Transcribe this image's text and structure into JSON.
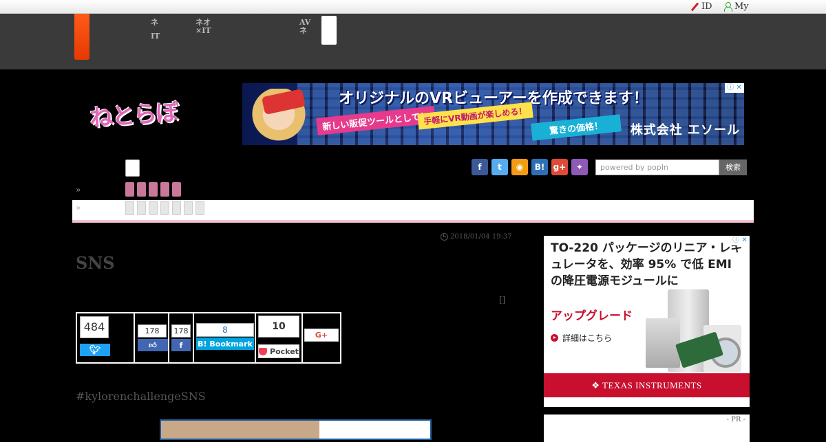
{
  "topbar": {
    "id_label": "ID",
    "my_label": "My"
  },
  "nav": {
    "item1": {
      "line1": "ネ",
      "line2": "IT"
    },
    "item2": {
      "line1": "ネオ",
      "line2": "×IT"
    },
    "item3": {
      "line1": "AV",
      "line2": "ネ"
    }
  },
  "logo": {
    "text": "ねとらぼ"
  },
  "vr_ad": {
    "headline": "オリジナルのVRビューアーを作成できます！",
    "tag1": "新しい販促ツールとして！",
    "tag2": "手軽にVR動画が楽しめる！",
    "tag3": "驚きの価格！",
    "company": "株式会社 エソール",
    "badge": "ⓘ ✕"
  },
  "social": {
    "icons": [
      {
        "name": "facebook-share-icon",
        "glyph": "f",
        "color": "#3b5998"
      },
      {
        "name": "twitter-share-icon",
        "glyph": "t",
        "color": "#55acee"
      },
      {
        "name": "rss-icon",
        "glyph": "◉",
        "color": "#f39c12"
      },
      {
        "name": "hatena-bookmark-icon",
        "glyph": "B!",
        "color": "#2f6fb6"
      },
      {
        "name": "google-plus-icon",
        "glyph": "g+",
        "color": "#dd4b39"
      },
      {
        "name": "mascot-cat-icon",
        "glyph": "✦",
        "color": "#8e5ab5"
      }
    ]
  },
  "search": {
    "placeholder": "powered by popIn",
    "button": "検索"
  },
  "crumbs": {
    "arrow1": "»",
    "arrow2": "»"
  },
  "article": {
    "date": "2018/01/04 19:37",
    "title": "SNS",
    "bracket": "[]",
    "hashtag": "#kylorenchallengeSNS"
  },
  "share": {
    "tweet_count": "484",
    "like_count": "178",
    "fb_share_count": "178",
    "bookmark_count": "8",
    "bookmark_label": "B! Bookmark",
    "pocket_count": "10",
    "pocket_label": "Pocket",
    "gplus_label": "G+"
  },
  "ti_ad": {
    "headline": "TO-220 パッケージのリニア・レギュレータを、効率 95% で低 EMI の降圧電源モジュールに",
    "upgrade": "アップグレード",
    "more": "詳細はこちら",
    "brand": "TEXAS INSTRUMENTS",
    "badge": "ⓘ ✕"
  },
  "pr": {
    "label": "- PR -"
  }
}
